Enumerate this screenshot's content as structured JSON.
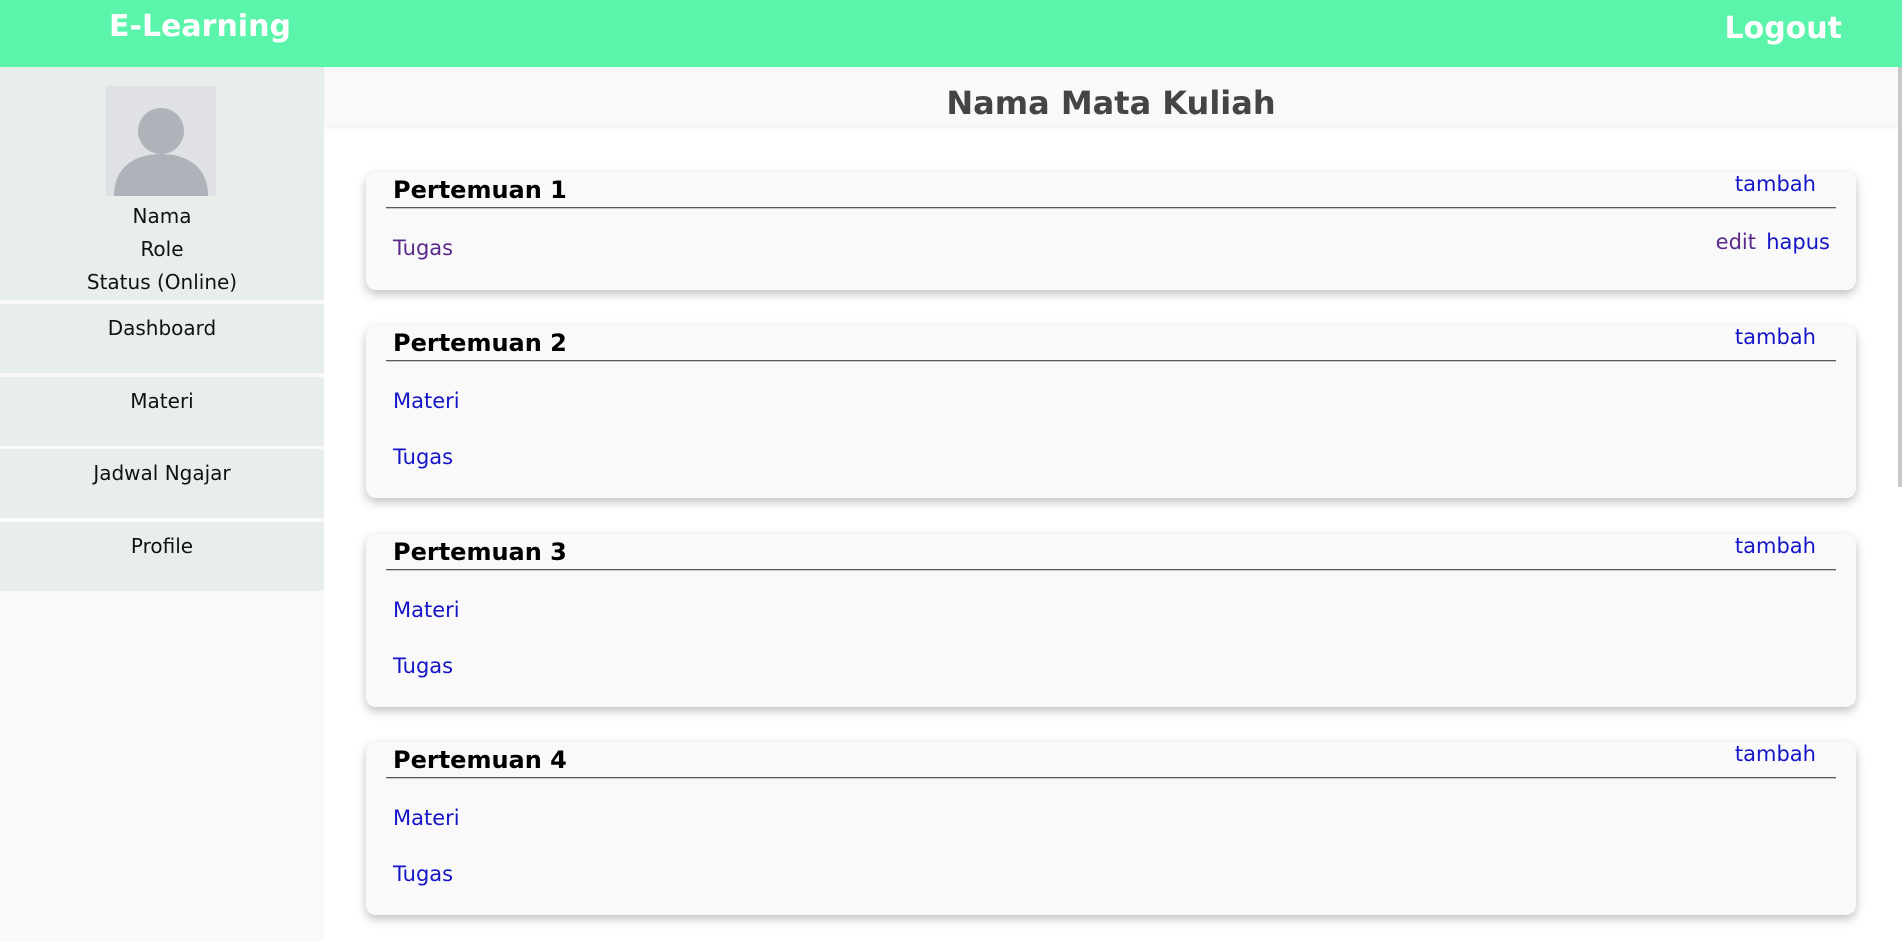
{
  "header": {
    "brand": "E-Learning",
    "logout": "Logout"
  },
  "sidebar": {
    "profile": {
      "name": "Nama",
      "role": "Role",
      "status": "Status (Online)"
    },
    "items": [
      {
        "label": "Dashboard"
      },
      {
        "label": "Materi"
      },
      {
        "label": "Jadwal Ngajar"
      },
      {
        "label": "Profile"
      }
    ]
  },
  "main": {
    "title": "Nama Mata Kuliah",
    "meetings": [
      {
        "title": "Pertemuan 1",
        "add": "tambah",
        "items": [
          {
            "label": "Tugas",
            "edit": "edit",
            "delete": "hapus"
          }
        ]
      },
      {
        "title": "Pertemuan 2",
        "add": "tambah",
        "items": [
          {
            "label": "Materi"
          },
          {
            "label": "Tugas"
          }
        ]
      },
      {
        "title": "Pertemuan 3",
        "add": "tambah",
        "items": [
          {
            "label": "Materi"
          },
          {
            "label": "Tugas"
          }
        ]
      },
      {
        "title": "Pertemuan 4",
        "add": "tambah",
        "items": [
          {
            "label": "Materi"
          },
          {
            "label": "Tugas"
          }
        ]
      }
    ]
  },
  "colors": {
    "topbar": "#5af5aa",
    "sidebar_item": "#e8efeb",
    "link": "#1515c8",
    "visited_link": "#5a2a8a"
  },
  "icons": {
    "avatar": "user-silhouette-icon"
  }
}
